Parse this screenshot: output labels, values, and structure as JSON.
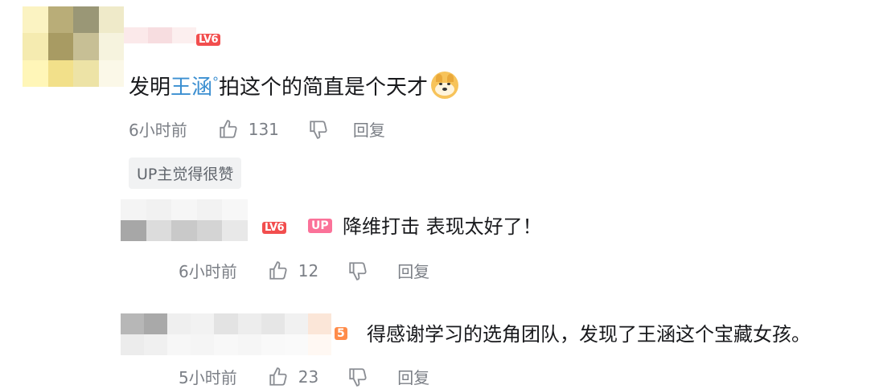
{
  "comments": [
    {
      "level_badge": "LV6",
      "text_prefix": "发明",
      "mention": "王涵",
      "mention_mark": "°",
      "text_suffix": "拍这个的简直是个天才",
      "emoji": "doge-emoji",
      "time": "6小时前",
      "likes": "131",
      "reply_label": "回复",
      "tag": "UP主觉得很赞"
    },
    {
      "level_badge": "LV6",
      "up_badge": "UP",
      "text": "降维打击 表现太好了！",
      "time": "6小时前",
      "likes": "12",
      "reply_label": "回复"
    },
    {
      "level_badge": "5",
      "text": "得感谢学习的选角团队，发现了王涵这个宝藏女孩。",
      "time": "5小时前",
      "likes": "23",
      "reply_label": "回复"
    }
  ],
  "colors": {
    "mention": "#3b8fd1",
    "level_badge": "#f24e4e",
    "up_badge": "#fb7299",
    "muted_text": "#7b7f86"
  }
}
